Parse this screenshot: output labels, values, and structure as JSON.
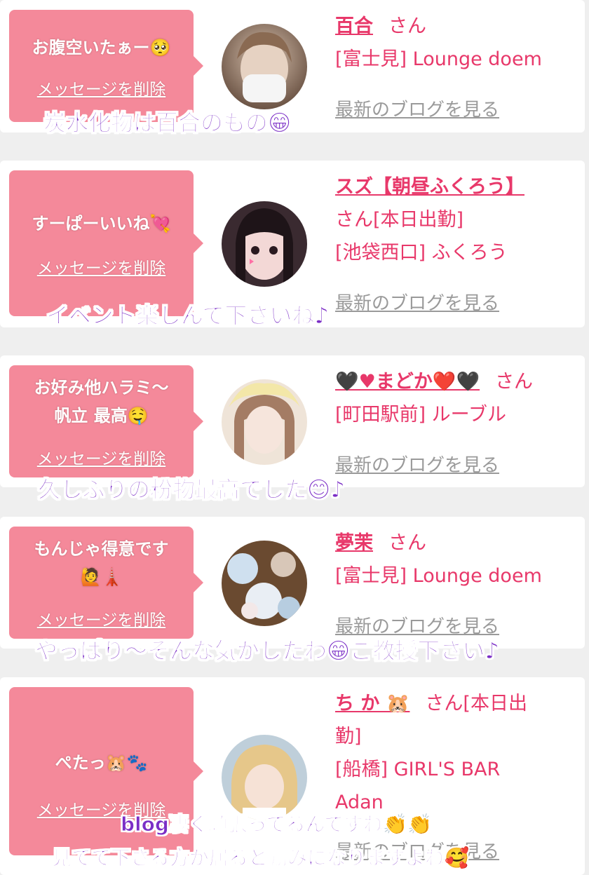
{
  "entries": [
    {
      "message": "お腹空いたぁー🥺",
      "delete_label": "メッセージを削除",
      "name": "百合",
      "san": "さん",
      "line2": "[富士見] Lounge doem",
      "line3": "",
      "blog_label": "最新のブログを見る",
      "overlay": "炭水化物は百合のもの😁"
    },
    {
      "message": "すーぱーいいね💘",
      "delete_label": "メッセージを削除",
      "name": "スズ【朝昼ふくろう】",
      "san": "さん[本日出勤]",
      "line2": "[池袋西口] ふくろう",
      "line3": "",
      "blog_label": "最新のブログを見る",
      "overlay": "イベント楽しんで下さいね♪"
    },
    {
      "message": "お好み他ハラミ〜帆立 最高🤤",
      "message_line1": "お好み他ハラミ〜",
      "message_line2": "帆立 最高🤤",
      "delete_label": "メッセージを削除",
      "name": "🖤♥まどか❤️🖤",
      "san": "さん",
      "line2": "[町田駅前] ルーブル",
      "line3": "",
      "blog_label": "最新のブログを見る",
      "overlay": "久しぶりの粉物最高でした😊♪"
    },
    {
      "message": "もんじゃ得意です🙋🗼",
      "message_line1": "もんじゃ得意です",
      "message_line2": "🙋🗼",
      "delete_label": "メッセージを削除",
      "name": "夢茉",
      "san": "さん",
      "line2": "[富士見] Lounge doem",
      "line3": "",
      "blog_label": "最新のブログを見る",
      "overlay": "やっぱり〜そんな気がしたわ😁ご教授下さい♪"
    },
    {
      "message": "ぺたっ🐹🐾",
      "delete_label": "メッセージを削除",
      "name": "ち か 🐹",
      "san": "さん[本日出",
      "san_line2": "勤]",
      "line2": "[船橋] GIRL'S BAR",
      "line3": "Adan",
      "blog_label": "最新のブログを見る",
      "overlay": "blog凄く頑張ってるんですね👏👏",
      "overlay2": "見てて下さる方が居ると励みになりますよね🥰"
    }
  ],
  "colors": {
    "bubble": "#f4899a",
    "name": "#e8386a",
    "overlay": "#7b2ec6",
    "blog_link": "#9a9a9a",
    "background": "#efefef"
  }
}
